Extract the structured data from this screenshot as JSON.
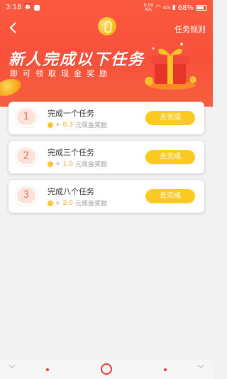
{
  "status_bar": {
    "time": "3:18",
    "network_speed_value": "0.00",
    "network_speed_unit": "K/s",
    "signal": "4G",
    "battery": "68%"
  },
  "header": {
    "rules_label": "任务规则",
    "banner_title": "新人完成以下任务",
    "banner_subtitle": "即可领取现金奖励"
  },
  "tasks": [
    {
      "number": "1",
      "title": "完成一个任务",
      "plus": "+",
      "amount": "0.3",
      "suffix": "元现金奖励",
      "button": "去完成"
    },
    {
      "number": "2",
      "title": "完成三个任务",
      "plus": "+",
      "amount": "1.0",
      "suffix": "元现金奖励",
      "button": "去完成"
    },
    {
      "number": "3",
      "title": "完成八个任务",
      "plus": "+",
      "amount": "2.0",
      "suffix": "元现金奖励",
      "button": "去完成"
    }
  ],
  "colors": {
    "header_red": "#f7513c",
    "button_yellow": "#fdc923",
    "reward_orange": "#f4a621",
    "nav_red": "#e53935"
  },
  "icons": {
    "back": "back-arrow-icon",
    "gift": "gift-box-icon",
    "coin": "coin-icon"
  }
}
